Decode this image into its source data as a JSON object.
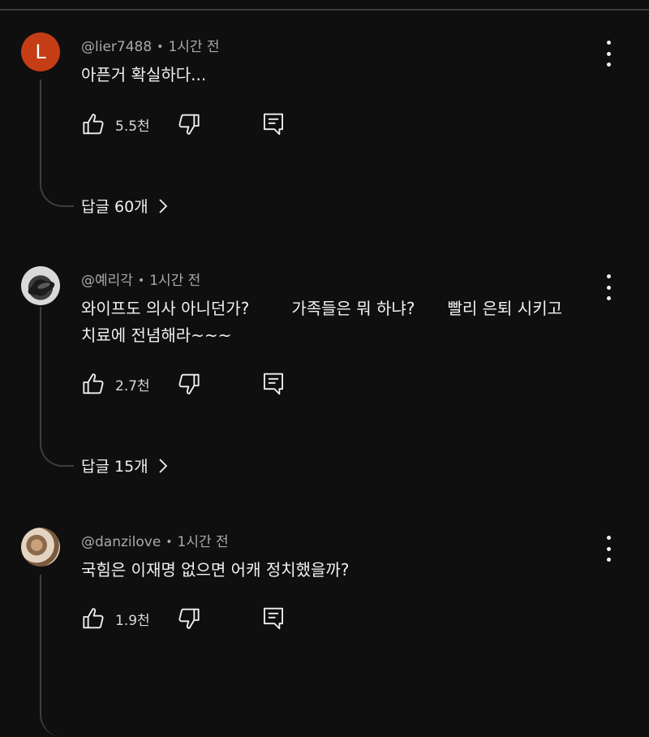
{
  "comments": [
    {
      "author": "@lier7488",
      "time": "1시간 전",
      "avatar_letter": "L",
      "text": [
        "아픈거 확실하다..."
      ],
      "likes": "5.5천",
      "replies": "답글 60개"
    },
    {
      "author": "@예리각",
      "time": "1시간 전",
      "text": [
        "와이프도 의사 아니던가?",
        "가족들은 뭐 하냐?",
        "빨리 은퇴 시키고",
        "치료에 전념해라~~~"
      ],
      "likes": "2.7천",
      "replies": "답글 15개"
    },
    {
      "author": "@danzilove",
      "time": "1시간 전",
      "text": [
        "국힘은 이재명 없으면 어캐 정치했을까?"
      ],
      "likes": "1.9천"
    }
  ],
  "colors": {
    "background": "#0f0f0f",
    "text": "#f1f1f1",
    "meta": "#aaaaaa",
    "avatar_l": "#c53d14"
  },
  "icons": [
    "thumbs-up-icon",
    "thumbs-down-icon",
    "reply-comment-icon",
    "more-vert-icon",
    "chevron-right-icon"
  ]
}
